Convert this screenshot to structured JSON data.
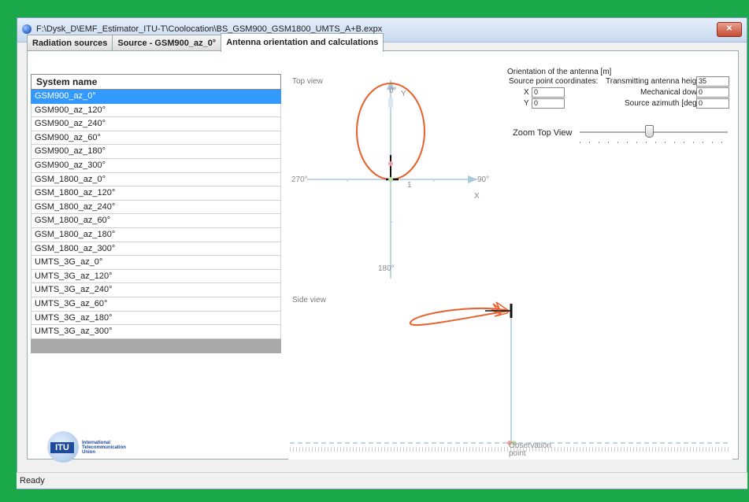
{
  "window": {
    "title": "F:\\Dysk_D\\EMF_Estimator_ITU-T\\Coolocation\\BS_GSM900_GSM1800_UMTS_A+B.expx",
    "close_label": "✕"
  },
  "tabs": [
    {
      "label": "Radiation sources"
    },
    {
      "label": "Source - GSM900_az_0°"
    },
    {
      "label": "Antenna orientation and calculations"
    }
  ],
  "system_list": {
    "header": "System name",
    "selected_index": 0,
    "items": [
      "GSM900_az_0°",
      "GSM900_az_120°",
      "GSM900_az_240°",
      "GSM900_az_60°",
      "GSM900_az_180°",
      "GSM900_az_300°",
      "GSM_1800_az_0°",
      "GSM_1800_az_120°",
      "GSM_1800_az_240°",
      "GSM_1800_az_60°",
      "GSM_1800_az_180°",
      "GSM_1800_az_300°",
      "UMTS_3G_az_0°",
      "UMTS_3G_az_120°",
      "UMTS_3G_az_240°",
      "UMTS_3G_az_60°",
      "UMTS_3G_az_180°",
      "UMTS_3G_az_300°"
    ]
  },
  "top_view": {
    "title": "Top view",
    "label_0": "0°",
    "label_y": "Y",
    "label_90": "90°",
    "label_270": "270°",
    "label_180": "180°",
    "label_x": "X",
    "label_1": "1"
  },
  "side_view": {
    "title": "Side view",
    "observation_point": "Observation point"
  },
  "orientation": {
    "legend": "Orientation of the antenna [m]",
    "source_coords_label": "Source point coordinates:",
    "x_label": "X",
    "x_value": "0",
    "y_label": "Y",
    "y_value": "0",
    "height_label": "Transmitting antenna height",
    "height_value": "35",
    "downtilt_label": "Mechanical downtilt",
    "downtilt_value": "0",
    "azimuth_label": "Source azimuth [deg]",
    "azimuth_value": "0"
  },
  "zoom": {
    "label": "Zoom Top View",
    "level": 0.47
  },
  "logo": {
    "abbr": "ITU",
    "text": "International\nTelecommunication\nUnion"
  },
  "status": {
    "text": "Ready"
  },
  "colors": {
    "pattern": "#e8602c",
    "axis": "#aac8dc",
    "selection": "#3399ff",
    "desktop": "#1aa84a"
  }
}
